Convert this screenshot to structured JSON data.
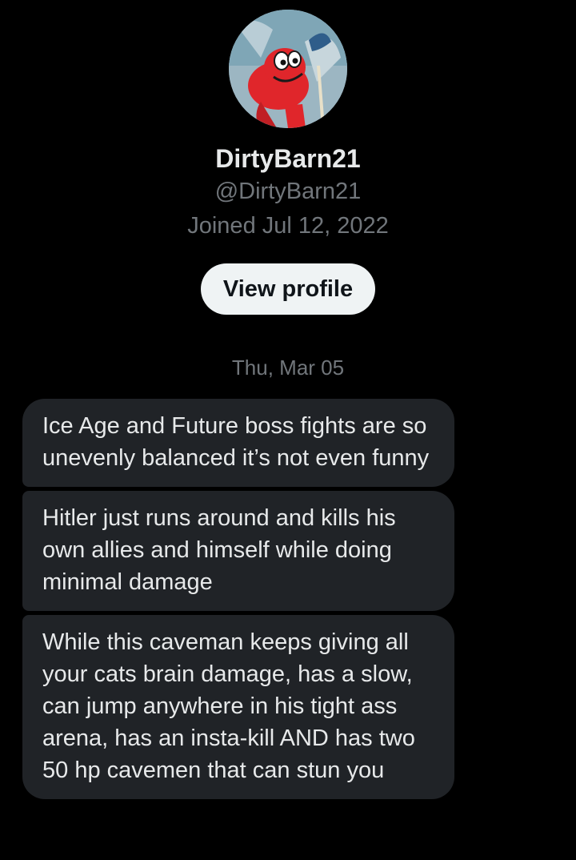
{
  "profile": {
    "display_name": "DirtyBarn21",
    "handle": "@DirtyBarn21",
    "joined": "Joined Jul 12, 2022",
    "view_profile_label": "View profile",
    "avatar_icon": "cartoon-character-avatar"
  },
  "conversation": {
    "date_separator": "Thu, Mar 05",
    "messages": [
      {
        "text": "Ice Age and Future boss fights are so unevenly balanced it’s not even funny"
      },
      {
        "text": "Hitler just runs around and kills his own allies and himself while doing minimal damage"
      },
      {
        "text": "While this caveman keeps giving all your cats brain damage, has a slow, can jump anywhere in his tight ass arena, has an insta-kill AND has two 50 hp cavemen that can stun you"
      }
    ]
  },
  "colors": {
    "background": "#000000",
    "bubble": "#202327",
    "primary_text": "#e7e9ea",
    "secondary_text": "#71767b",
    "button_bg": "#eff3f4"
  }
}
